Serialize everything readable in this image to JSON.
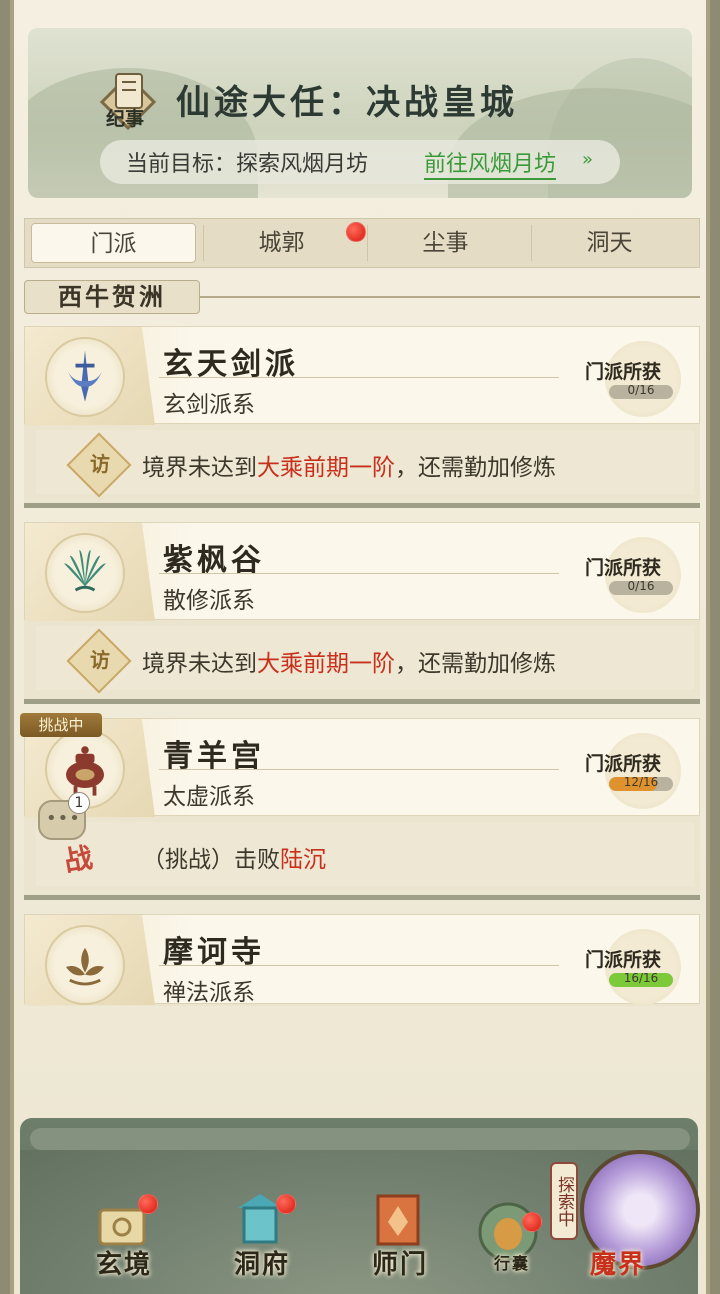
{
  "banner": {
    "emblem_text": "纪事",
    "title": "仙途大任：决战皇城",
    "goal_label": "当前目标：探索风烟月坊",
    "goal_link": "前往风烟月坊"
  },
  "tabs": [
    {
      "label": "门派",
      "active": true
    },
    {
      "label": "城郭",
      "has_badge": true
    },
    {
      "label": "尘事"
    },
    {
      "label": "洞天"
    }
  ],
  "region": {
    "label": "西牛贺洲"
  },
  "sects": [
    {
      "name": "玄天剑派",
      "school": "玄剑派系",
      "gain_label": "门派所获",
      "gain_text": "0/16",
      "gain_fraction": 0.0,
      "icon": "sword-emblem-icon",
      "requirement_prefix": "境界未达到",
      "requirement_highlight": "大乘前期一阶",
      "requirement_suffix": "，还需勤加修炼",
      "visit_char": "访"
    },
    {
      "name": "紫枫谷",
      "school": "散修派系",
      "gain_label": "门派所获",
      "gain_text": "0/16",
      "gain_fraction": 0.0,
      "icon": "leaf-fan-icon",
      "requirement_prefix": "境界未达到",
      "requirement_highlight": "大乘前期一阶",
      "requirement_suffix": "，还需勤加修炼",
      "visit_char": "访"
    },
    {
      "name": "青羊宫",
      "school": "太虚派系",
      "gain_label": "门派所获",
      "gain_text": "12/16",
      "gain_fraction": 0.75,
      "icon": "incense-burner-icon",
      "challenge_badge": "挑战中",
      "chat_count": "1",
      "war_char": "战",
      "challenge_prefix": "（挑战）击败",
      "challenge_target": "陆沉"
    },
    {
      "name": "摩诃寺",
      "school": "禅法派系",
      "gain_label": "门派所获",
      "gain_text": "16/16",
      "gain_fraction": 1.0,
      "icon": "lotus-icon"
    }
  ],
  "nav": [
    {
      "label": "玄境",
      "icon": "scroll-icon",
      "has_badge": true
    },
    {
      "label": "洞府",
      "icon": "lantern-pavilion-icon",
      "has_badge": true
    },
    {
      "label": "师门",
      "icon": "banner-flag-icon",
      "has_badge": false
    },
    {
      "label": "行囊",
      "icon": "pouch-icon",
      "has_badge": true
    },
    {
      "label": "魔界",
      "icon": "demon-realm-icon",
      "has_badge": false,
      "tag": "探索中"
    }
  ],
  "colors": {
    "highlight_red": "#c8301c",
    "link_green": "#3a9a3a",
    "badge_red": "#d8180c",
    "progress_partial": "#e0922e",
    "progress_full": "#7cc93a"
  }
}
